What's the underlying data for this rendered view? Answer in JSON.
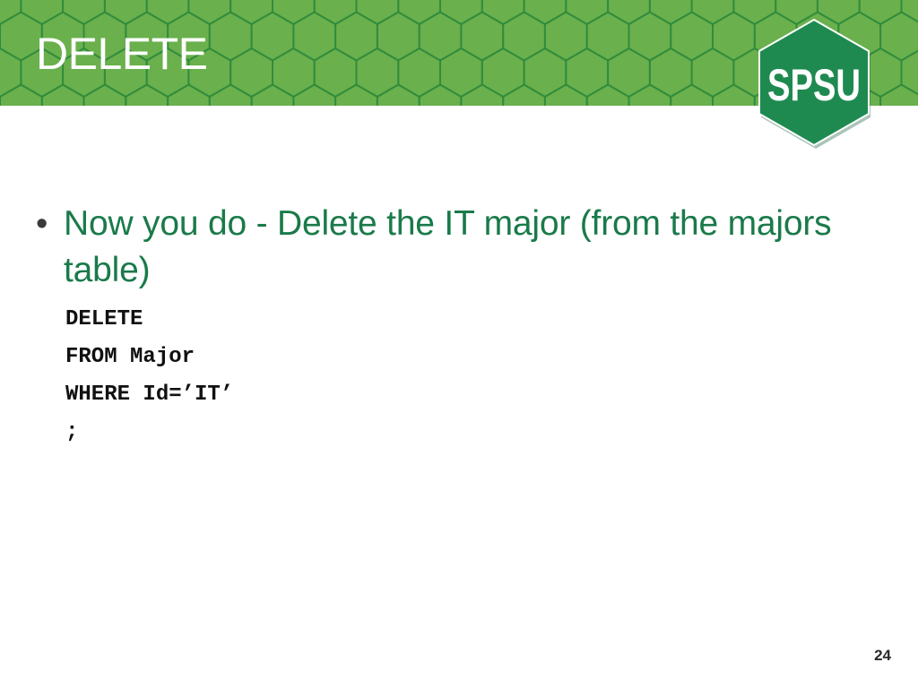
{
  "slide": {
    "title": "DELETE",
    "logo_text": "SPSU",
    "bullet_symbol": "•",
    "bullet_text": "Now you do - Delete the IT major (from the majors table)",
    "code_lines": [
      "DELETE",
      "FROM Major",
      "WHERE Id=’IT’",
      ";"
    ],
    "page_number": "24"
  },
  "colors": {
    "header_green": "#6ab04c",
    "hex_stroke": "#2f8a3c",
    "logo_green": "#1e8a50",
    "bullet_text_green": "#1a7a4a"
  }
}
